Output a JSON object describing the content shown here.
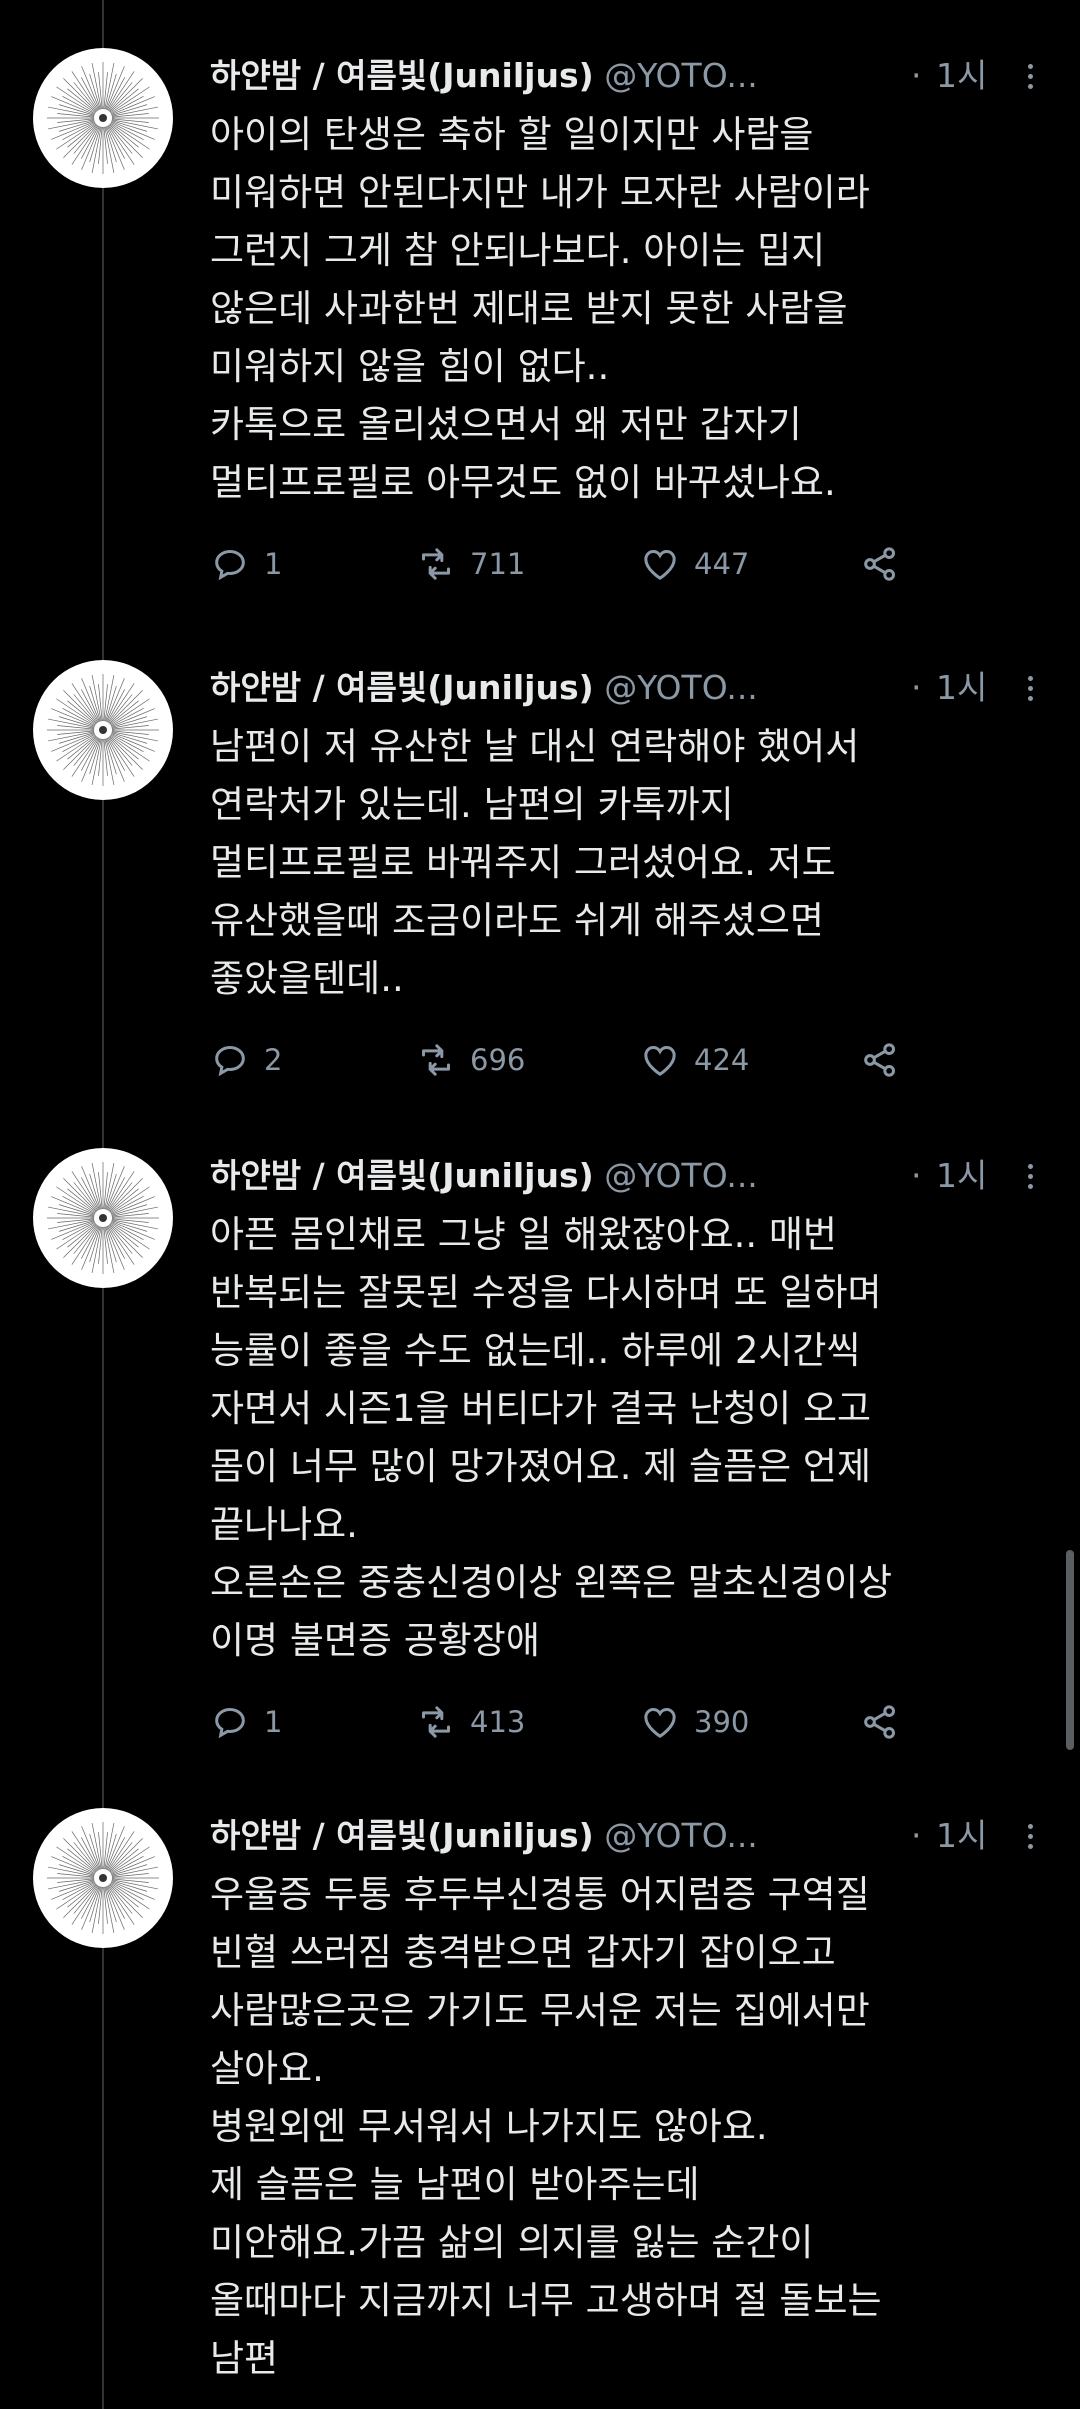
{
  "author": {
    "name": "하얀밤 / 여름빛(Juniljus)",
    "handle": "@YOTO...",
    "dot": "·",
    "time": "1시"
  },
  "tweets": [
    {
      "text": "아이의 탄생은 축하 할 일이지만 사람을\n미워하면 안된다지만 내가 모자란 사람이라\n그런지 그게 참 안되나보다. 아이는 밉지\n않은데 사과한번 제대로 받지 못한 사람을\n미워하지 않을 힘이 없다..\n카톡으로 올리셨으면서 왜 저만 갑자기\n멀티프로필로 아무것도 없이 바꾸셨나요.",
      "replies": "1",
      "retweets": "711",
      "likes": "447"
    },
    {
      "text": "남편이 저 유산한 날 대신 연락해야 했어서\n연락처가 있는데. 남편의 카톡까지\n멀티프로필로 바꿔주지 그러셨어요. 저도\n유산했을때 조금이라도 쉬게 해주셨으면\n좋았을텐데..",
      "replies": "2",
      "retweets": "696",
      "likes": "424"
    },
    {
      "text": "아픈 몸인채로 그냥 일 해왔잖아요.. 매번\n반복되는 잘못된 수정을 다시하며 또 일하며\n능률이 좋을 수도 없는데.. 하루에 2시간씩\n자면서 시즌1을 버티다가 결국 난청이 오고\n몸이 너무 많이 망가졌어요. 제 슬픔은 언제\n끝나나요.\n오른손은 중충신경이상 왼쪽은 말초신경이상\n이명 불면증 공황장애",
      "replies": "1",
      "retweets": "413",
      "likes": "390"
    },
    {
      "text": "우울증 두통 후두부신경통 어지럼증 구역질\n빈혈 쓰러짐 충격받으면 갑자기 잡이오고\n사람많은곳은 가기도 무서운 저는 집에서만\n살아요.\n병원외엔 무서워서 나가지도 않아요.\n제 슬픔은 늘 남편이 받아주는데\n미안해요.가끔 삶의 의지를 잃는 순간이\n올때마다 지금까지 너무 고생하며 절 돌보는\n남편"
    }
  ],
  "icons": {
    "reply": "reply-icon",
    "retweet": "retweet-icon",
    "like": "like-icon",
    "share": "share-icon",
    "more": "more-icon"
  },
  "colors": {
    "background": "#000000",
    "text": "#e7e9ea",
    "muted": "#8b98a5",
    "thread_line": "#2f3336"
  }
}
